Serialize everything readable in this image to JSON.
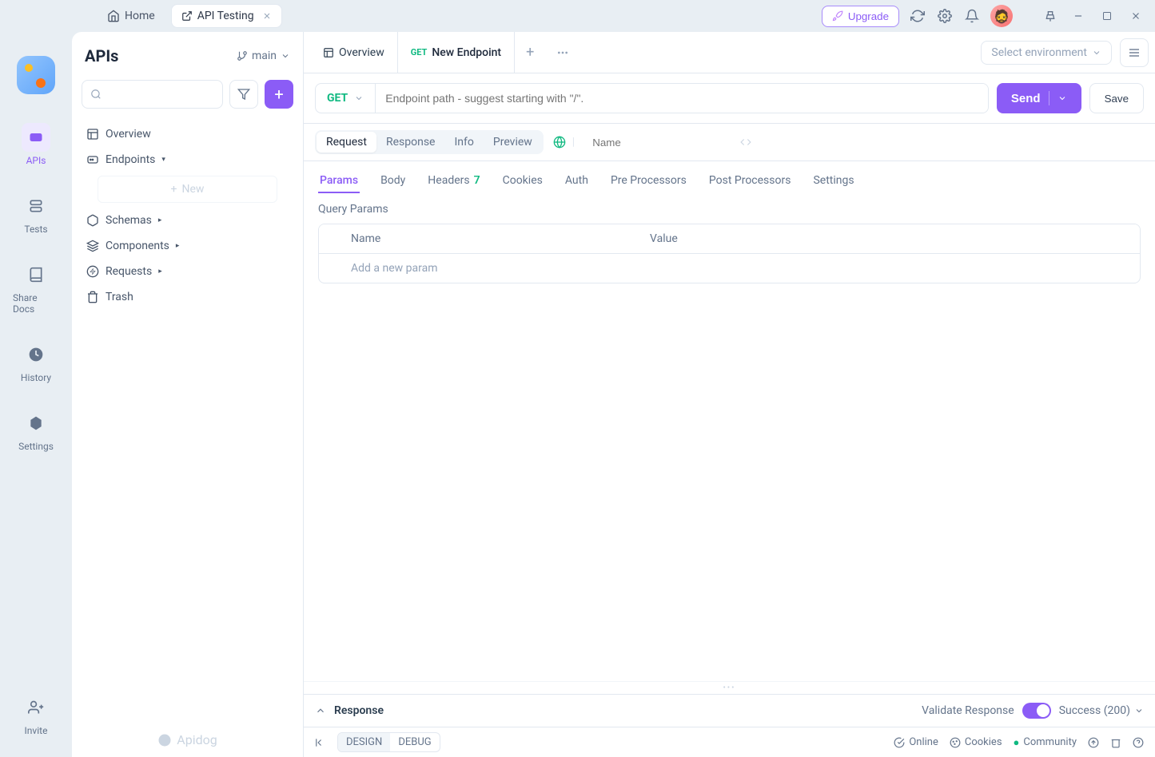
{
  "titlebar": {
    "home_label": "Home",
    "project_label": "API Testing",
    "upgrade_label": "Upgrade"
  },
  "rail": {
    "items": [
      {
        "label": "APIs"
      },
      {
        "label": "Tests"
      },
      {
        "label": "Share Docs"
      },
      {
        "label": "History"
      },
      {
        "label": "Settings"
      }
    ],
    "invite_label": "Invite"
  },
  "sidebar": {
    "title": "APIs",
    "branch": "main",
    "tree": {
      "overview": "Overview",
      "endpoints": "Endpoints",
      "new_label": "New",
      "schemas": "Schemas",
      "components": "Components",
      "requests": "Requests",
      "trash": "Trash"
    },
    "footer_brand": "Apidog"
  },
  "main": {
    "tabs": [
      {
        "label": "Overview"
      },
      {
        "method": "GET",
        "label": "New Endpoint"
      }
    ],
    "env_placeholder": "Select environment"
  },
  "request": {
    "method": "GET",
    "path_placeholder": "Endpoint path - suggest starting with \"/\".",
    "send_label": "Send",
    "save_label": "Save"
  },
  "view_tabs": {
    "items": [
      "Request",
      "Response",
      "Info",
      "Preview"
    ],
    "name_placeholder": "Name"
  },
  "section_tabs": {
    "params": "Params",
    "body": "Body",
    "headers": "Headers",
    "headers_count": "7",
    "cookies": "Cookies",
    "auth": "Auth",
    "pre": "Pre Processors",
    "post": "Post Processors",
    "settings": "Settings"
  },
  "params": {
    "section_label": "Query Params",
    "col_name": "Name",
    "col_value": "Value",
    "add_placeholder": "Add a new param"
  },
  "response_bar": {
    "title": "Response",
    "validate_label": "Validate Response",
    "status_label": "Success (200)"
  },
  "status_bar": {
    "design": "DESIGN",
    "debug": "DEBUG",
    "online": "Online",
    "cookies": "Cookies",
    "community": "Community"
  }
}
